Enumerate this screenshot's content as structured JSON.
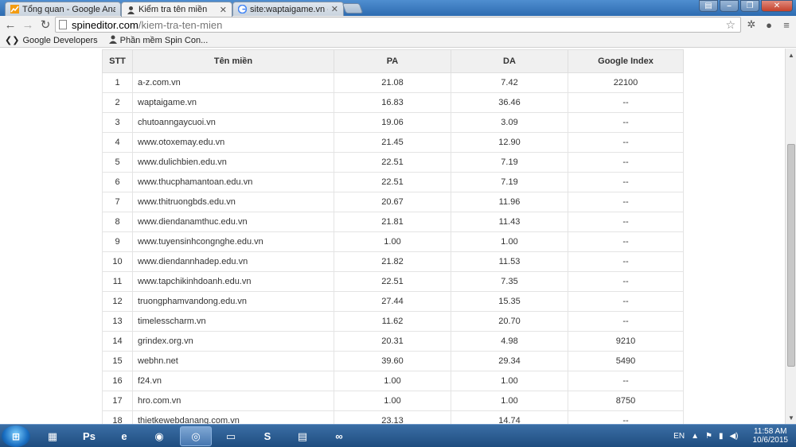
{
  "browser": {
    "tabs": [
      {
        "label": "Tổng quan - Google Anal",
        "icon": "analytics-icon"
      },
      {
        "label": "Kiểm tra tên miền",
        "icon": "user-icon",
        "active": true
      },
      {
        "label": "site:waptaigame.vn - Tìm",
        "icon": "google-icon"
      }
    ],
    "url_host": "spineditor.com",
    "url_path": "/kiem-tra-ten-mien",
    "bookmarks": [
      {
        "label": "Google Developers",
        "icon": "developers-icon"
      },
      {
        "label": "Phần mềm Spin Con...",
        "icon": "user-icon"
      }
    ]
  },
  "table": {
    "headers": [
      "STT",
      "Tên miền",
      "PA",
      "DA",
      "Google Index"
    ],
    "rows": [
      [
        "1",
        "a-z.com.vn",
        "21.08",
        "7.42",
        "22100"
      ],
      [
        "2",
        "waptaigame.vn",
        "16.83",
        "36.46",
        "--"
      ],
      [
        "3",
        "chutoanngaycuoi.vn",
        "19.06",
        "3.09",
        "--"
      ],
      [
        "4",
        "www.otoxemay.edu.vn",
        "21.45",
        "12.90",
        "--"
      ],
      [
        "5",
        "www.dulichbien.edu.vn",
        "22.51",
        "7.19",
        "--"
      ],
      [
        "6",
        "www.thucphamantoan.edu.vn",
        "22.51",
        "7.19",
        "--"
      ],
      [
        "7",
        "www.thitruongbds.edu.vn",
        "20.67",
        "11.96",
        "--"
      ],
      [
        "8",
        "www.diendanamthuc.edu.vn",
        "21.81",
        "11.43",
        "--"
      ],
      [
        "9",
        "www.tuyensinhcongnghe.edu.vn",
        "1.00",
        "1.00",
        "--"
      ],
      [
        "10",
        "www.diendannhadep.edu.vn",
        "21.82",
        "11.53",
        "--"
      ],
      [
        "11",
        "www.tapchikinhdoanh.edu.vn",
        "22.51",
        "7.35",
        "--"
      ],
      [
        "12",
        "truongphamvandong.edu.vn",
        "27.44",
        "15.35",
        "--"
      ],
      [
        "13",
        "timelesscharm.vn",
        "11.62",
        "20.70",
        "--"
      ],
      [
        "14",
        "grindex.org.vn",
        "20.31",
        "4.98",
        "9210"
      ],
      [
        "15",
        "webhn.net",
        "39.60",
        "29.34",
        "5490"
      ],
      [
        "16",
        "f24.vn",
        "1.00",
        "1.00",
        "--"
      ],
      [
        "17",
        "hro.com.vn",
        "1.00",
        "1.00",
        "8750"
      ],
      [
        "18",
        "thietkewebdanang.com.vn",
        "23.13",
        "14.74",
        "--"
      ]
    ]
  },
  "taskbar": {
    "apps": [
      {
        "name": "taskbar-app-grid",
        "glyph": "▦"
      },
      {
        "name": "taskbar-app-photoshop",
        "glyph": "Ps"
      },
      {
        "name": "taskbar-app-ie",
        "glyph": "e"
      },
      {
        "name": "taskbar-app-firefox",
        "glyph": "◉"
      },
      {
        "name": "taskbar-app-chrome",
        "glyph": "◎"
      },
      {
        "name": "taskbar-app-folder-green",
        "glyph": "▭"
      },
      {
        "name": "taskbar-app-skype",
        "glyph": "S"
      },
      {
        "name": "taskbar-app-explorer",
        "glyph": "▤"
      },
      {
        "name": "taskbar-app-network",
        "glyph": "∞"
      }
    ],
    "language": "EN",
    "time": "11:58 AM",
    "date": "10/6/2015"
  }
}
